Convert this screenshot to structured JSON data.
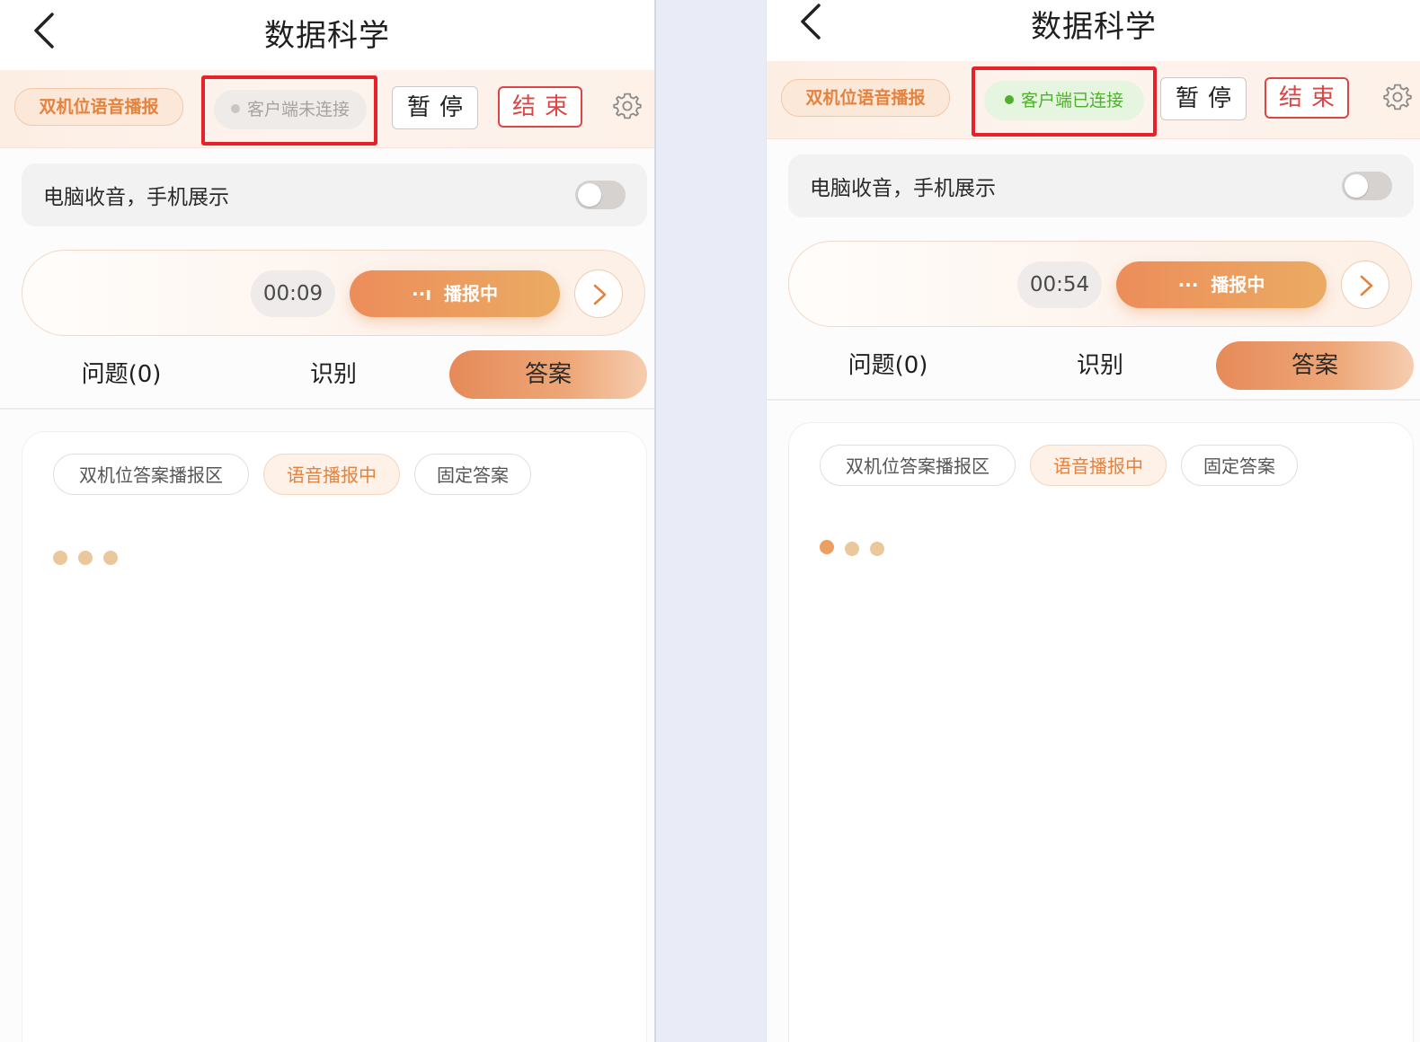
{
  "colors": {
    "accent": "#e4823f",
    "danger": "#de4444",
    "connected": "#4fb02f",
    "highlight_box": "#e8202a"
  },
  "panels": [
    {
      "title": "数据科学",
      "dual_broadcast_label": "双机位语音播报",
      "client_status": "客户端未连接",
      "client_connected": false,
      "pause_label": "暂停",
      "end_label": "结束",
      "toggle_label": "电脑收音，手机展示",
      "toggle_on": false,
      "timer": "00:09",
      "broadcast_label": "播报中",
      "tabs": [
        "问题(0)",
        "识别",
        "答案"
      ],
      "active_tab": "答案",
      "chips": [
        "双机位答案播报区",
        "语音播报中",
        "固定答案"
      ],
      "active_chip": "语音播报中"
    },
    {
      "title": "数据科学",
      "dual_broadcast_label": "双机位语音播报",
      "client_status": "客户端已连接",
      "client_connected": true,
      "pause_label": "暂停",
      "end_label": "结束",
      "toggle_label": "电脑收音，手机展示",
      "toggle_on": false,
      "timer": "00:54",
      "broadcast_label": "播报中",
      "tabs": [
        "问题(0)",
        "识别",
        "答案"
      ],
      "active_tab": "答案",
      "chips": [
        "双机位答案播报区",
        "语音播报中",
        "固定答案"
      ],
      "active_chip": "语音播报中"
    }
  ],
  "icons": [
    "back-arrow-icon",
    "gear-icon",
    "chevron-right-icon",
    "ellipsis-icon",
    "typing-dots-icon"
  ]
}
